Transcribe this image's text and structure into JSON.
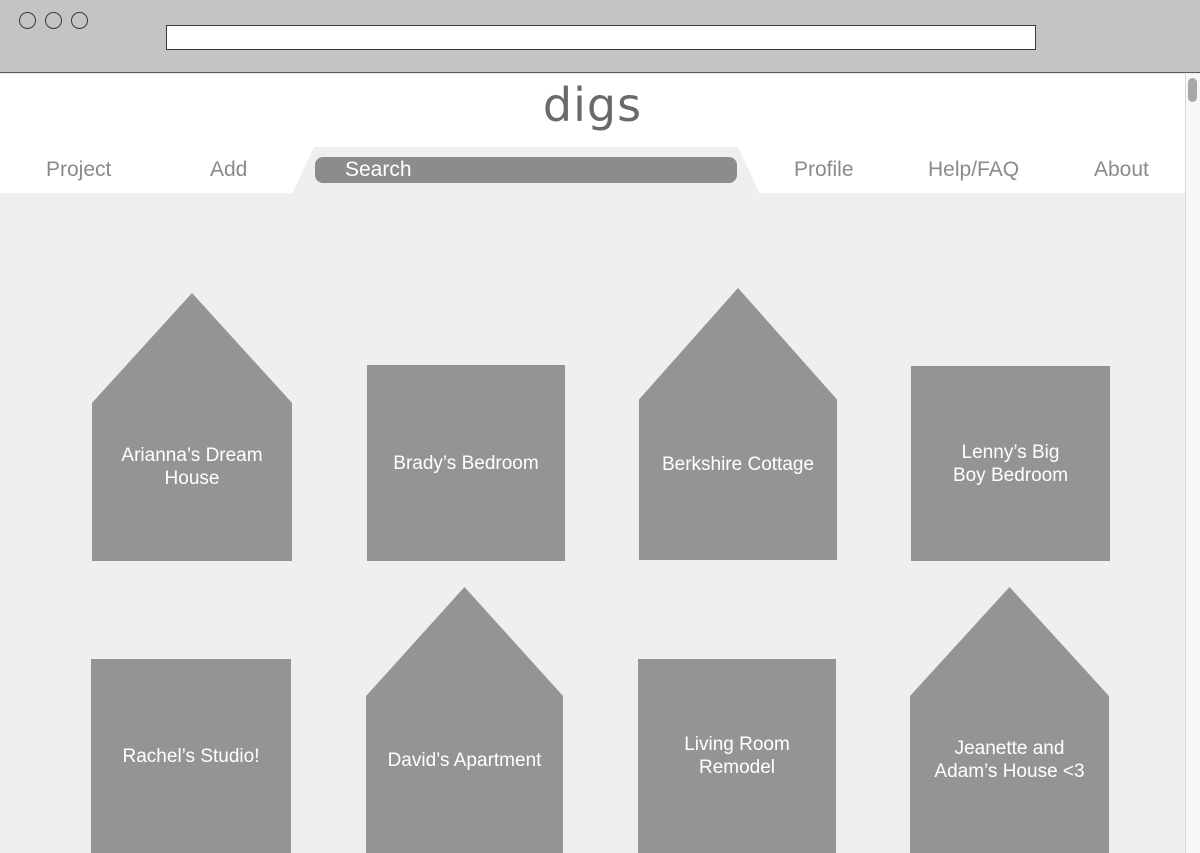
{
  "app": {
    "logo": "digs"
  },
  "nav": {
    "items": [
      {
        "name": "nav-project",
        "label": "Project"
      },
      {
        "name": "nav-add",
        "label": "Add"
      },
      {
        "name": "nav-profile",
        "label": "Profile"
      },
      {
        "name": "nav-help",
        "label": "Help/FAQ"
      },
      {
        "name": "nav-about",
        "label": "About"
      }
    ],
    "search_label": "Search"
  },
  "projects": [
    {
      "label": "Arianna’s Dream House",
      "shape": "house"
    },
    {
      "label": "Brady’s Bedroom",
      "shape": "square"
    },
    {
      "label": "Berkshire Cottage",
      "shape": "house"
    },
    {
      "label": "Lenny’s Big Boy Bedroom",
      "shape": "square"
    },
    {
      "label": "Rachel’s Studio!",
      "shape": "square"
    },
    {
      "label": "David’s Apartment",
      "shape": "house"
    },
    {
      "label": "Living Room Remodel",
      "shape": "square"
    },
    {
      "label": "Jeanette and Adam’s House <3",
      "shape": "house"
    }
  ],
  "colors": {
    "card": "#949494",
    "background": "#efefef",
    "chrome": "#c4c4c4",
    "search": "#8c8c8c"
  }
}
